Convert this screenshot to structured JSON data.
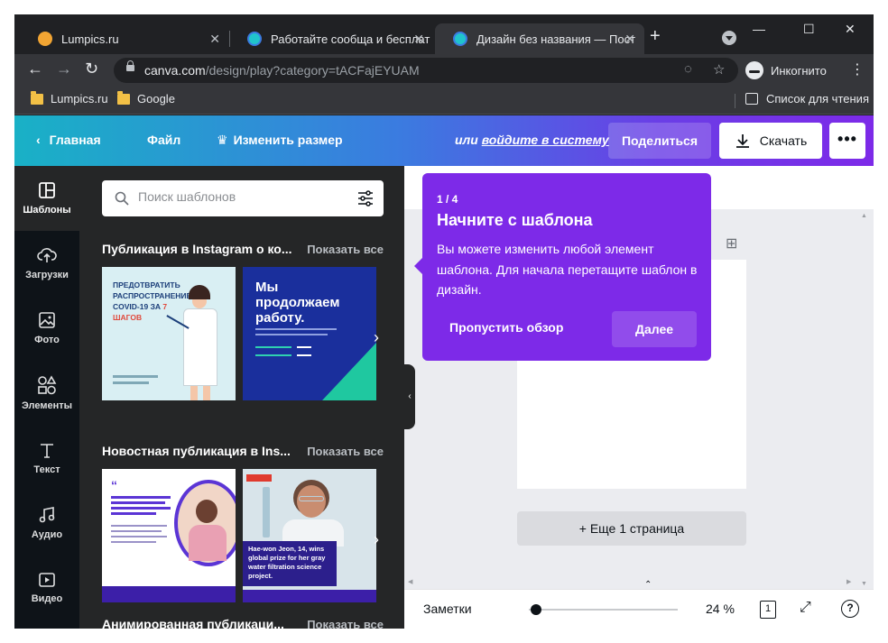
{
  "browser": {
    "tabs": [
      {
        "title": "Lumpics.ru",
        "close": "✕"
      },
      {
        "title": "Работайте сообща и бесплат",
        "close": "✕"
      },
      {
        "title": "Дизайн без названия — Пост",
        "close": "✕"
      }
    ],
    "new_tab": "+",
    "window_controls": {
      "minimize": "—",
      "maximize": "☐",
      "close": "✕"
    },
    "nav": {
      "back": "←",
      "forward": "→",
      "reload": "↻"
    },
    "url_host": "canva.com",
    "url_path": "/design/play?category=tACFajEYUAM",
    "incognito_label": "Инкогнито",
    "menu": "⋮",
    "bookmarks": [
      "Lumpics.ru",
      "Google"
    ],
    "reading_list": "Список для чтения"
  },
  "canva_header": {
    "home": "Главная",
    "file": "Файл",
    "resize": "Изменить размер",
    "login_prefix": "или ",
    "login_link": "войдите в систему",
    "share": "Поделиться",
    "download": "Скачать",
    "more": "•••"
  },
  "rail": [
    {
      "label": "Шаблоны",
      "icon": "templates-icon"
    },
    {
      "label": "Загрузки",
      "icon": "upload-icon"
    },
    {
      "label": "Фото",
      "icon": "photo-icon"
    },
    {
      "label": "Элементы",
      "icon": "elements-icon"
    },
    {
      "label": "Текст",
      "icon": "text-icon"
    },
    {
      "label": "Аудио",
      "icon": "audio-icon"
    },
    {
      "label": "Видео",
      "icon": "video-icon"
    }
  ],
  "panel": {
    "search_placeholder": "Поиск шаблонов",
    "sections": [
      {
        "title": "Публикация в Instagram о ко...",
        "more": "Показать все"
      },
      {
        "title": "Новостная публикация в Ins...",
        "more": "Показать все"
      },
      {
        "title": "Анимированная публикаци...",
        "more": "Показать все"
      }
    ],
    "templates": {
      "covid_title": "ПРЕДОТВРАТИТЬ РАСПРОСТРАНЕНИЕ COVID-19 ЗА",
      "covid_highlight": "7 ШАГОВ",
      "work_title": "Мы продолжаем работу.",
      "hae_won_caption": "Hae-won Jeon, 14, wins global prize for her gray water filtration science project."
    }
  },
  "editor": {
    "add_page": "+ Еще 1 страница",
    "notes": "Заметки",
    "zoom": "24 %",
    "page_count": "1",
    "help": "?",
    "expand": "⤢",
    "zoom_level": 0.05
  },
  "tour": {
    "step": "1 / 4",
    "title": "Начните с шаблона",
    "body": "Вы можете изменить любой элемент шаблона. Для начала перетащите шаблон в дизайн.",
    "skip": "Пропустить обзор",
    "next": "Далее"
  },
  "colors": {
    "canva_purple": "#7d2ae8",
    "canva_teal": "#19b1c6",
    "rail_bg": "#0e1318",
    "panel_bg": "#252627"
  }
}
